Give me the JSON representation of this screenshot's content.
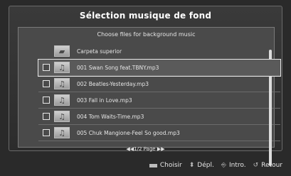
{
  "dialog": {
    "title": "Sélection musique de fond",
    "subtitle": "Choose files for background music"
  },
  "list": {
    "items": [
      {
        "label": "Carpeta superior",
        "icon": "folder-icon",
        "checkbox": false
      },
      {
        "label": "001 Swan Song feat.TBNY.mp3",
        "icon": "music-note-icon",
        "checkbox": true,
        "selected": true
      },
      {
        "label": "002 Beatles-Yesterday.mp3",
        "icon": "music-note-icon",
        "checkbox": true
      },
      {
        "label": "003 Fall in Love.mp3",
        "icon": "music-note-icon",
        "checkbox": true
      },
      {
        "label": "004 Tom Waits-Time.mp3",
        "icon": "music-note-icon",
        "checkbox": true
      },
      {
        "label": "005 Chuk Mangione-Feel So good.mp3",
        "icon": "music-note-icon",
        "checkbox": true
      }
    ],
    "pager": "◀◀1/2 Page ▶▶"
  },
  "footer": {
    "choose": "Choisir",
    "move": "Dépl.",
    "intro": "Intro.",
    "back": "Retour"
  },
  "colors": {
    "background": "#2a2a2a",
    "panel": "#4a4a4a",
    "text": "#e6e6e6",
    "title": "#ffffff"
  }
}
